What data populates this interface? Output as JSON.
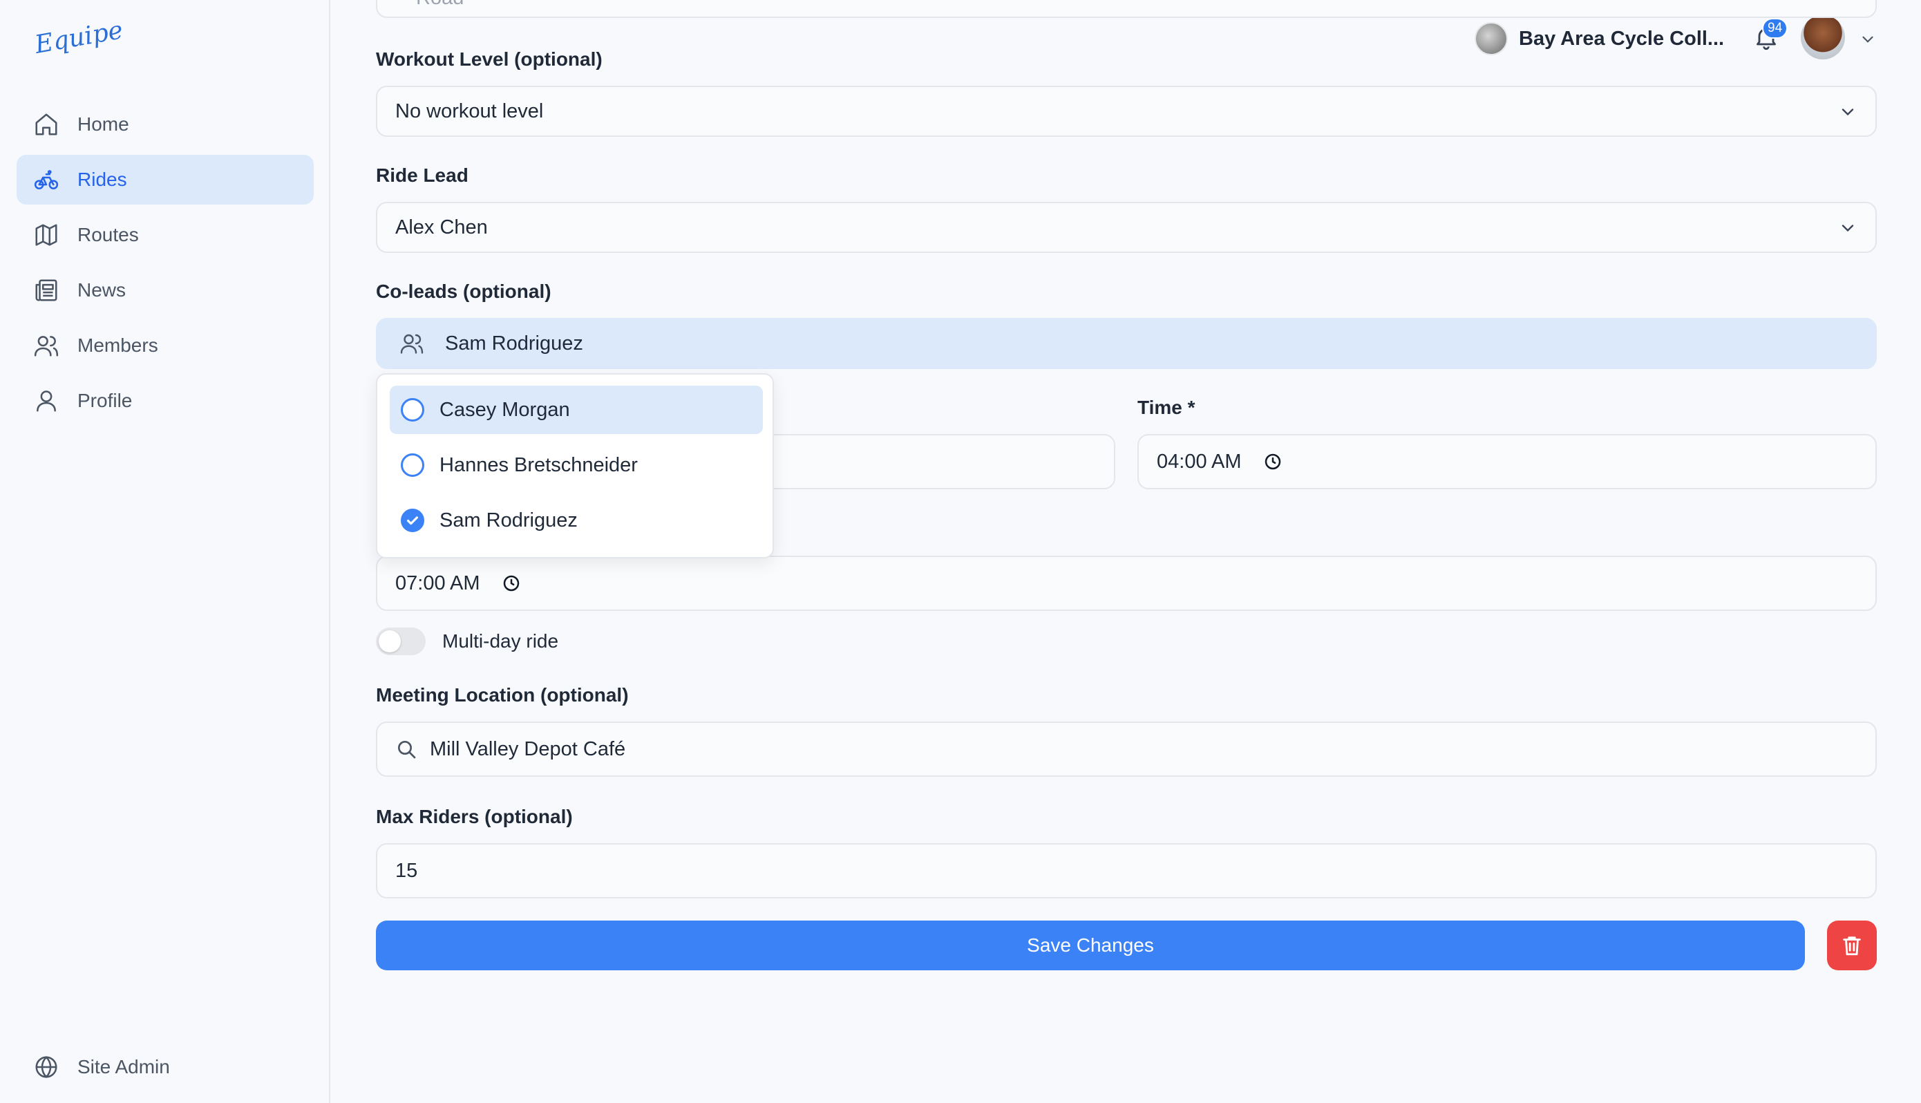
{
  "app": {
    "logo_text": "Equipe"
  },
  "sidebar": {
    "items": [
      {
        "label": "Home",
        "icon": "home-icon"
      },
      {
        "label": "Rides",
        "icon": "bicycle-icon",
        "active": true
      },
      {
        "label": "Routes",
        "icon": "map-icon"
      },
      {
        "label": "News",
        "icon": "newspaper-icon"
      },
      {
        "label": "Members",
        "icon": "users-icon"
      },
      {
        "label": "Profile",
        "icon": "user-icon"
      }
    ],
    "footer": {
      "label": "Site Admin",
      "icon": "globe-icon"
    }
  },
  "header": {
    "club_name": "Bay Area Cycle Coll...",
    "notification_count": "94"
  },
  "form": {
    "top_partial_value": "Road",
    "workout_level": {
      "label": "Workout Level (optional)",
      "value": "No workout level"
    },
    "ride_lead": {
      "label": "Ride Lead",
      "value": "Alex Chen"
    },
    "coleads": {
      "label": "Co-leads (optional)",
      "value": "Sam Rodriguez"
    },
    "time": {
      "label": "Time *",
      "value": "04:00 AM"
    },
    "end_time": {
      "value": "07:00 AM"
    },
    "multi_day": {
      "label": "Multi-day ride",
      "checked": false
    },
    "meeting_location": {
      "label": "Meeting Location (optional)",
      "value": "Mill Valley Depot Café"
    },
    "max_riders": {
      "label": "Max Riders (optional)",
      "value": "15"
    },
    "save_label": "Save Changes"
  },
  "coleads_dropdown": {
    "options": [
      {
        "label": "Casey Morgan",
        "checked": false,
        "highlighted": true
      },
      {
        "label": "Hannes Bretschneider",
        "checked": false
      },
      {
        "label": "Sam Rodriguez",
        "checked": true
      }
    ]
  },
  "colors": {
    "accent": "#3b82f6",
    "active_bg": "#dce9fb",
    "danger": "#ef4444"
  }
}
